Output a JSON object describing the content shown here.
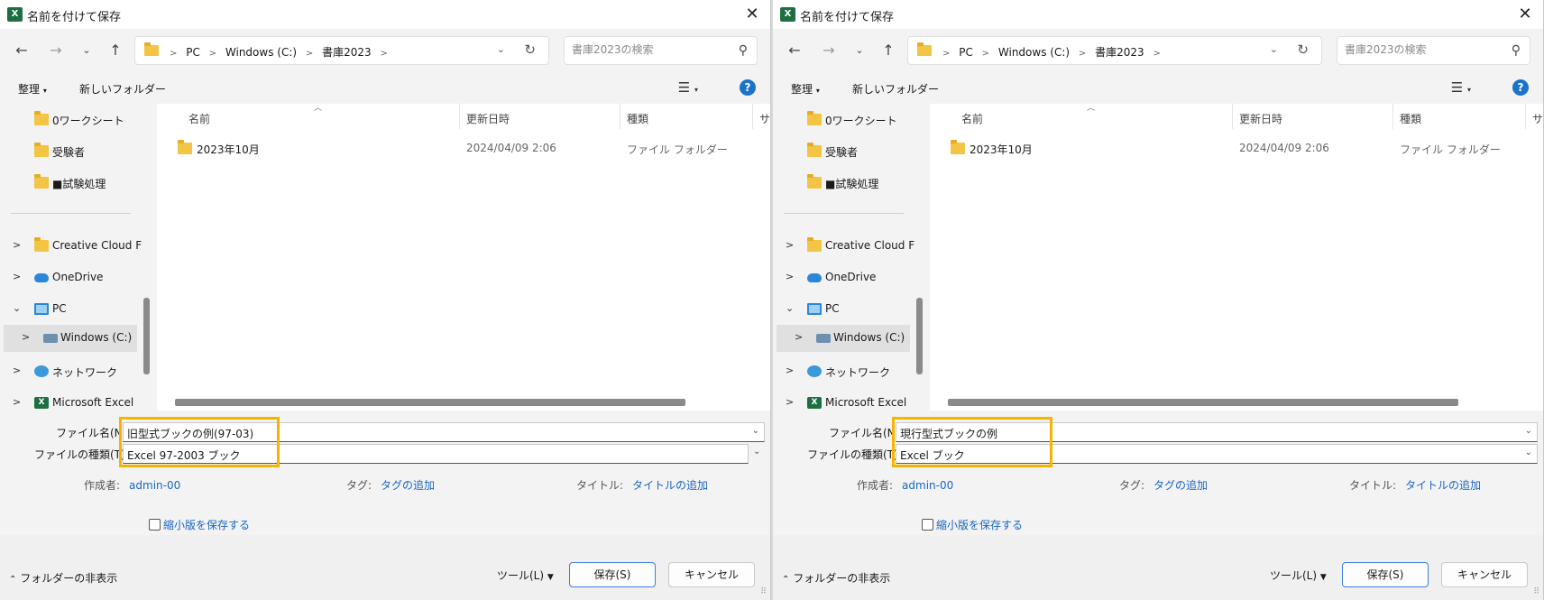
{
  "dialogs": [
    {
      "title": "名前を付けて保存",
      "app_icon": "excel-icon",
      "breadcrumb": [
        "PC",
        "Windows (C:)",
        "書庫2023"
      ],
      "search_placeholder": "書庫2023の検索",
      "toolbar": {
        "organize": "整理",
        "new_folder": "新しいフォルダー"
      },
      "sidebar": {
        "pinned": [
          "0ワークシート",
          "受験者",
          "■試験処理"
        ],
        "tree": [
          "Creative Cloud F",
          "OneDrive",
          "PC",
          "Windows (C:)",
          "ネットワーク",
          "Microsoft Excel"
        ]
      },
      "columns": [
        "名前",
        "更新日時",
        "種類",
        "サ"
      ],
      "rows": [
        {
          "name": "2023年10月",
          "date": "2024/04/09 2:06",
          "type": "ファイル フォルダー"
        }
      ],
      "file_name_label": "ファイル名(N):",
      "file_name": "旧型式ブックの例(97-03)",
      "file_type_label": "ファイルの種類(T):",
      "file_type": "Excel 97-2003 ブック",
      "author_label": "作成者:",
      "author": "admin-00",
      "tags_label": "タグ:",
      "tags": "タグの追加",
      "title_label": "タイトル:",
      "title_value": "タイトルの追加",
      "thumbnail_label": "縮小版を保存する",
      "hide_folders": "フォルダーの非表示",
      "tools": "ツール(L)",
      "save": "保存(S)",
      "cancel": "キャンセル"
    },
    {
      "title": "名前を付けて保存",
      "app_icon": "excel-icon",
      "breadcrumb": [
        "PC",
        "Windows (C:)",
        "書庫2023"
      ],
      "search_placeholder": "書庫2023の検索",
      "toolbar": {
        "organize": "整理",
        "new_folder": "新しいフォルダー"
      },
      "sidebar": {
        "pinned": [
          "0ワークシート",
          "受験者",
          "■試験処理"
        ],
        "tree": [
          "Creative Cloud F",
          "OneDrive",
          "PC",
          "Windows (C:)",
          "ネットワーク",
          "Microsoft Excel"
        ]
      },
      "columns": [
        "名前",
        "更新日時",
        "種類",
        "サ"
      ],
      "rows": [
        {
          "name": "2023年10月",
          "date": "2024/04/09 2:06",
          "type": "ファイル フォルダー"
        }
      ],
      "file_name_label": "ファイル名(N):",
      "file_name": "現行型式ブックの例",
      "file_type_label": "ファイルの種類(T):",
      "file_type": "Excel ブック",
      "author_label": "作成者:",
      "author": "admin-00",
      "tags_label": "タグ:",
      "tags": "タグの追加",
      "title_label": "タイトル:",
      "title_value": "タイトルの追加",
      "thumbnail_label": "縮小版を保存する",
      "hide_folders": "フォルダーの非表示",
      "tools": "ツール(L)",
      "save": "保存(S)",
      "cancel": "キャンセル"
    }
  ],
  "colors": {
    "highlight": "#f5b400",
    "link": "#1a66c2",
    "folder": "#f3c445",
    "excel": "#1d6f42"
  }
}
